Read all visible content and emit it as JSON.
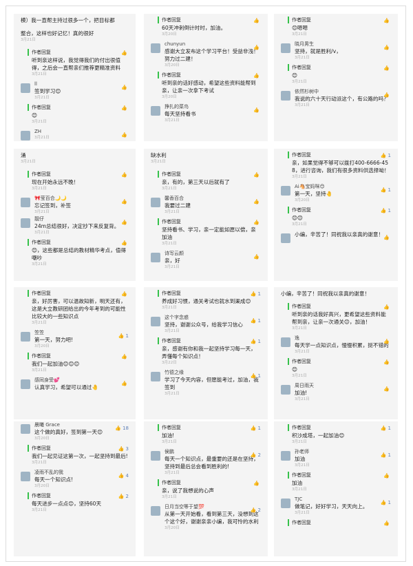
{
  "panels": [
    [
      {
        "kind": "text",
        "text": "模）我一直帮主持过很多一个，把目标都",
        "date": ""
      },
      {
        "kind": "text",
        "text": "整合，这样也好记忆！真的很好",
        "date": "3月21日"
      },
      {
        "kind": "reply",
        "author": "作者回复",
        "text": "听到亲这样说，我觉得我们的付出很值得，之后会一直帮亲们推荐更精准资料",
        "date": "3月21日",
        "like": ""
      },
      {
        "kind": "user",
        "name": "ll",
        "text": "签到学习😊",
        "date": "3月21日",
        "like": ""
      },
      {
        "kind": "reply",
        "author": "作者回复",
        "text": "😊",
        "date": "3月21日",
        "like": ""
      },
      {
        "kind": "user",
        "name": "ZH",
        "text": "",
        "date": "3月21日",
        "like": ""
      }
    ],
    [
      {
        "kind": "reply",
        "author": "作者回复",
        "text": "60天冲刺倒计时时，加油。",
        "date": "3月20日",
        "like": ""
      },
      {
        "kind": "user",
        "name": "chunyun",
        "text": "感谢大立发布这个学习平台！受益非浅！努力过二建！",
        "date": "3月20日",
        "like": ""
      },
      {
        "kind": "reply",
        "author": "作者回复",
        "text": "听到亲的话好感动，希望这些资料能帮到亲，让亲一次拿下考试",
        "date": "3月20日",
        "like": ""
      },
      {
        "kind": "user",
        "name": "挣扎的菜鸟",
        "text": "每天坚持看书",
        "date": "3月21日",
        "like": ""
      }
    ],
    [
      {
        "kind": "reply",
        "author": "作者回复",
        "text": "😊嗯嗯",
        "date": "3月21日",
        "like": ""
      },
      {
        "kind": "user",
        "name": "晓月男生",
        "text": "坚持，就是胜利/v，",
        "date": "3月21日",
        "like": ""
      },
      {
        "kind": "reply",
        "author": "作者回复",
        "text": "😊",
        "date": "3月21日",
        "like": ""
      },
      {
        "kind": "user",
        "name": "依然杉树中",
        "text": "我说的六十天行动派这个，有公路的吗？",
        "date": "3月21日",
        "like": ""
      }
    ],
    [
      {
        "kind": "text",
        "text": "涌",
        "date": "3月21日"
      },
      {
        "kind": "reply",
        "author": "作者回复",
        "text": "现在开始永远不晚！",
        "date": "3月21日",
        "like": ""
      },
      {
        "kind": "user",
        "name": "🎀莹百合🌙🌙",
        "text": "忘记签到，补签",
        "date": "3月21日",
        "like": ""
      },
      {
        "kind": "user",
        "name": "靓仔",
        "text": "24m总结很好，决定抄下来反复背。",
        "date": "3月21日",
        "like": ""
      },
      {
        "kind": "reply",
        "author": "作者回复",
        "text": "😊，这些都是总结的教材精华考点，值得嘲吵",
        "date": "3月21日",
        "like": ""
      }
    ],
    [
      {
        "kind": "text",
        "text": "缺水利",
        "date": "3月21日"
      },
      {
        "kind": "reply",
        "author": "作者回复",
        "text": "亲，有的，第三天以后就有了",
        "date": "3月21日",
        "like": ""
      },
      {
        "kind": "user",
        "name": "馨香百合",
        "text": "我要过二建",
        "date": "3月21日",
        "like": ""
      },
      {
        "kind": "reply",
        "author": "作者回复",
        "text": "坚持看书、学习，亲一定能如愿以偿，亲加油",
        "date": "3月21日",
        "like": ""
      },
      {
        "kind": "user",
        "name": "诗写云颜",
        "text": "亲，好",
        "date": "3月21日",
        "like": ""
      }
    ],
    [
      {
        "kind": "reply",
        "author": "作者回复",
        "text": "亲，如果觉得不够可以拨打400-6666-458，进行咨询，我们有很多资料供选择呦！",
        "date": "3月21日",
        "like": "1"
      },
      {
        "kind": "user",
        "name": "Ai🐴宝妈咪😊",
        "text": "第一天，坚持🤚",
        "date": "3月20日",
        "like": "1"
      },
      {
        "kind": "reply",
        "author": "作者回复",
        "text": "😊😊",
        "date": "3月21日",
        "like": "1"
      },
      {
        "kind": "user",
        "name": "",
        "text": "小编，辛苦了！同祝我以亲真的谢意！",
        "date": "",
        "like": ""
      }
    ],
    [
      {
        "kind": "reply",
        "author": "作者回复",
        "text": "亲，好厉害，可以温故知新，明天还有，这是大立教研团给出的今年考到的可能性比较大的一些知识点",
        "date": "3月21日",
        "like": ""
      },
      {
        "kind": "user",
        "name": "笠笠",
        "text": "第一天，努力吧!",
        "date": "3月20日",
        "like": "1"
      },
      {
        "kind": "reply",
        "author": "作者回复",
        "text": "我们一起加油😊😊😊",
        "date": "3月21日",
        "like": ""
      },
      {
        "kind": "user",
        "name": "感同身受💕",
        "text": "认真学习，希望可以通过🤚",
        "date": "",
        "like": ""
      }
    ],
    [
      {
        "kind": "reply",
        "author": "作者回复",
        "text": "养成好习惯，通关考试也就水到渠成😊",
        "date": "3月21日",
        "like": "1"
      },
      {
        "kind": "user",
        "name": "这个字念惑",
        "text": "坚持，谢谢公众号，给我学习信心",
        "date": "3月21日",
        "like": "1"
      },
      {
        "kind": "reply",
        "author": "作者回复",
        "text": "亲，感谢有你和我一起坚持学习每一天，弄懂每个知识点！",
        "date": "3月22日",
        "like": "1"
      },
      {
        "kind": "user",
        "name": "竹德之缘",
        "text": "学习了今天内容，但愿能考过，加油，我签到",
        "date": "3月21日",
        "like": "1"
      }
    ],
    [
      {
        "kind": "text",
        "text": "小编，辛苦了！同祝我以亲真的谢意！",
        "date": ""
      },
      {
        "kind": "reply",
        "author": "作者回复",
        "text": "听到亲的话我好高兴，更希望这些资料能帮到亲，让亲一次通关😊，加油！",
        "date": "3月21日",
        "like": ""
      },
      {
        "kind": "user",
        "name": "逸",
        "text": "每天学一点知识点，慢慢积累，挺不错的",
        "date": "3月21日",
        "like": ""
      },
      {
        "kind": "reply",
        "author": "作者回复",
        "text": "😊",
        "date": "3月21日",
        "like": ""
      },
      {
        "kind": "user",
        "name": "周日雨天",
        "text": "加油!",
        "date": "3月21日",
        "like": ""
      }
    ],
    [
      {
        "kind": "user",
        "name": "晨曦 Grace",
        "text": "这个做的真好，签到第一天😊",
        "date": "3月20日",
        "like": "18"
      },
      {
        "kind": "reply",
        "author": "作者回复",
        "text": "我们一起见证这第一次，一起坚持到最后!",
        "date": "3月21日",
        "like": "3"
      },
      {
        "kind": "user",
        "name": "凌雨不乱的我",
        "text": "每天一个知识点!",
        "date": "3月20日",
        "like": "4"
      },
      {
        "kind": "reply",
        "author": "作者回复",
        "text": "每天进步一点点😊，坚持60天",
        "date": "3月21日",
        "like": "2"
      }
    ],
    [
      {
        "kind": "reply",
        "author": "作者回复",
        "text": "加油!",
        "date": "3月21日",
        "like": "1"
      },
      {
        "kind": "user",
        "name": "侯鹏",
        "text": "每天一个知识点，最重要的还是在坚持，坚持到最后总会看到胜利的!",
        "date": "3月21日",
        "like": "2"
      },
      {
        "kind": "reply",
        "author": "作者回复",
        "text": "亲，说了我想说的心声",
        "date": "3月21日",
        "like": ""
      },
      {
        "kind": "user",
        "name": "日月当空等于望💯",
        "text": "从第一天开始看，看到第三天，没想到这个这个好，谢谢亲亲小编，我可怜的水利",
        "date": "3月20日",
        "like": "2"
      }
    ],
    [
      {
        "kind": "reply",
        "author": "作者回复",
        "text": "积沙成塔，一起加油😊",
        "date": "3月21日",
        "like": "1"
      },
      {
        "kind": "user",
        "name": "孙老师",
        "text": "加油",
        "date": "3月21日",
        "like": "1"
      },
      {
        "kind": "reply",
        "author": "作者回复",
        "text": "加油",
        "date": "3月21日",
        "like": ""
      },
      {
        "kind": "user",
        "name": "TJC",
        "text": "做笔记，好好学习，天天向上。",
        "date": "3月21日",
        "like": "1"
      },
      {
        "kind": "reply",
        "author": "作者回复",
        "text": "",
        "date": "",
        "like": ""
      }
    ]
  ]
}
